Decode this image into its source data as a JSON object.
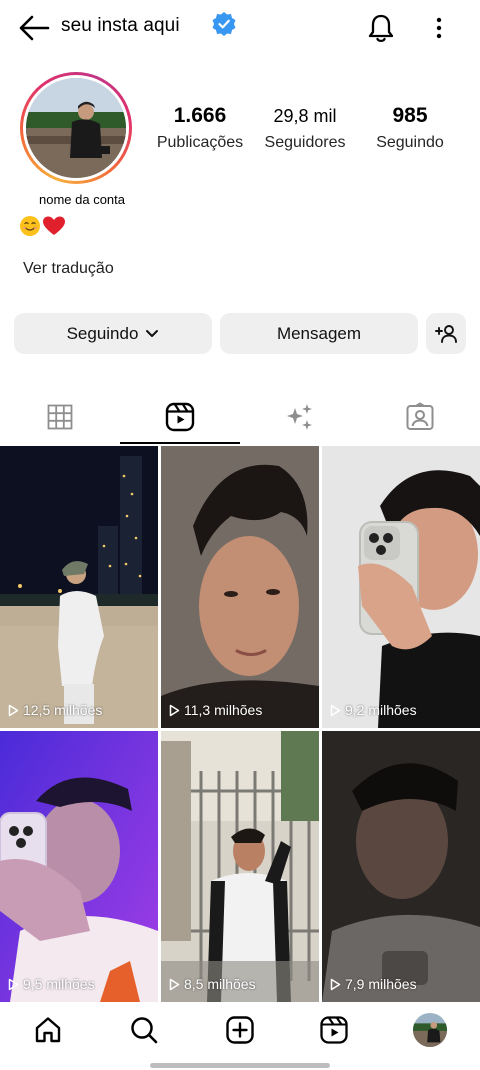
{
  "header": {
    "username": "seu insta aqui",
    "icons": [
      "back-arrow-icon",
      "verified-badge-icon",
      "bell-icon",
      "more-vertical-icon"
    ],
    "verified_color": "#3897f0"
  },
  "profile": {
    "stats": [
      {
        "value": "1.666",
        "label": "Publicações"
      },
      {
        "value": "29,8 mil",
        "label": "Seguidores"
      },
      {
        "value": "985",
        "label": "Seguindo"
      }
    ],
    "account_name": "nome da conta",
    "bio_emojis": [
      "😊",
      "❤️"
    ],
    "translate_label": "Ver tradução"
  },
  "actions": {
    "following_label": "Seguindo",
    "message_label": "Mensagem",
    "icons": [
      "chevron-down-icon",
      "add-person-icon"
    ]
  },
  "tabs": [
    {
      "name": "posts-grid",
      "icon": "grid-icon",
      "active": false
    },
    {
      "name": "reels",
      "icon": "reels-icon",
      "active": true
    },
    {
      "name": "effects",
      "icon": "sparkles-icon",
      "active": false
    },
    {
      "name": "tagged",
      "icon": "tagged-user-icon",
      "active": false
    }
  ],
  "reels": [
    {
      "views": "12,5 milhões"
    },
    {
      "views": "11,3 milhões"
    },
    {
      "views": "9,2 milhões"
    },
    {
      "views": "9,5 milhões"
    },
    {
      "views": "8,5 milhões"
    },
    {
      "views": "7,9 milhões"
    }
  ],
  "bottom_nav": [
    {
      "icon": "home-icon"
    },
    {
      "icon": "search-icon"
    },
    {
      "icon": "create-post-icon"
    },
    {
      "icon": "reels-icon"
    },
    {
      "icon": "profile-avatar"
    }
  ]
}
